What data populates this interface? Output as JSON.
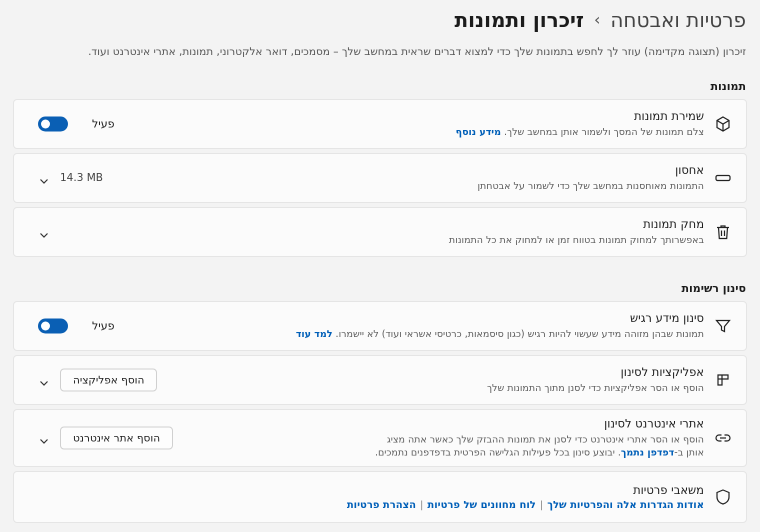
{
  "breadcrumb": {
    "parent": "פרטיות ואבטחה",
    "separator": "›",
    "current": "זיכרון ותמונות"
  },
  "description": "זיכרון (תצוגה מקדימה) עוזר לך לחפש בתמונות שלך כדי למצוא דברים שראית במחשב שלך – מסמכים, דואר אלקטרוני, תמונות, אתרי אינטרנט ועוד.",
  "sections": {
    "snapshots_title": "תמונות",
    "filter_title": "סינון רשימות"
  },
  "save_snapshots": {
    "title": "שמירת תמונות",
    "sub": "צלם תמונות של המסך ולשמור אותן במחשב שלך.",
    "link": "מידע נוסף",
    "state_label": "פעיל",
    "on": true
  },
  "storage": {
    "title": "אחסון",
    "sub": "התמונות מאוחסנות במחשב שלך כדי לשמור על אבטחתן",
    "value": "14.3 MB"
  },
  "delete_snapshots": {
    "title": "מחק תמונות",
    "sub": "באפשרותך למחוק תמונות בטווח זמן או למחוק את כל התמונות"
  },
  "sensitive_filter": {
    "title": "סינון מידע רגיש",
    "sub": "תמונות שבהן מזוהה מידע שעשוי להיות רגיש (כגון סיסמאות, כרטיסי אשראי ועוד) לא יישמרו.",
    "link": "למד עוד",
    "state_label": "פעיל",
    "on": true
  },
  "apps_filter": {
    "title": "אפליקציות לסינון",
    "sub": "הוסף או הסר אפליקציות כדי לסנן מתוך התמונות שלך",
    "button": "הוסף אפליקציה"
  },
  "sites_filter": {
    "title": "אתרי אינטרנט לסינון",
    "sub1": "הוסף או הסר אתרי אינטרנט כדי לסנן את תמונות ההבזק שלך כאשר אתה מציג אותן ב-",
    "sub_link": "דפדפן נתמך",
    "sub2": ". יבוצע סינון בכל פעילות הגלישה הפרטית בדפדפנים נתמכים.",
    "button": "הוסף אתר אינטרנט"
  },
  "privacy": {
    "title": "משאבי פרטיות",
    "links": [
      "אודות הגדרות אלה והפרטיות שלך",
      "לוח מחוונים של פרטיות",
      "הצהרת פרטיות"
    ],
    "separator": "|"
  }
}
